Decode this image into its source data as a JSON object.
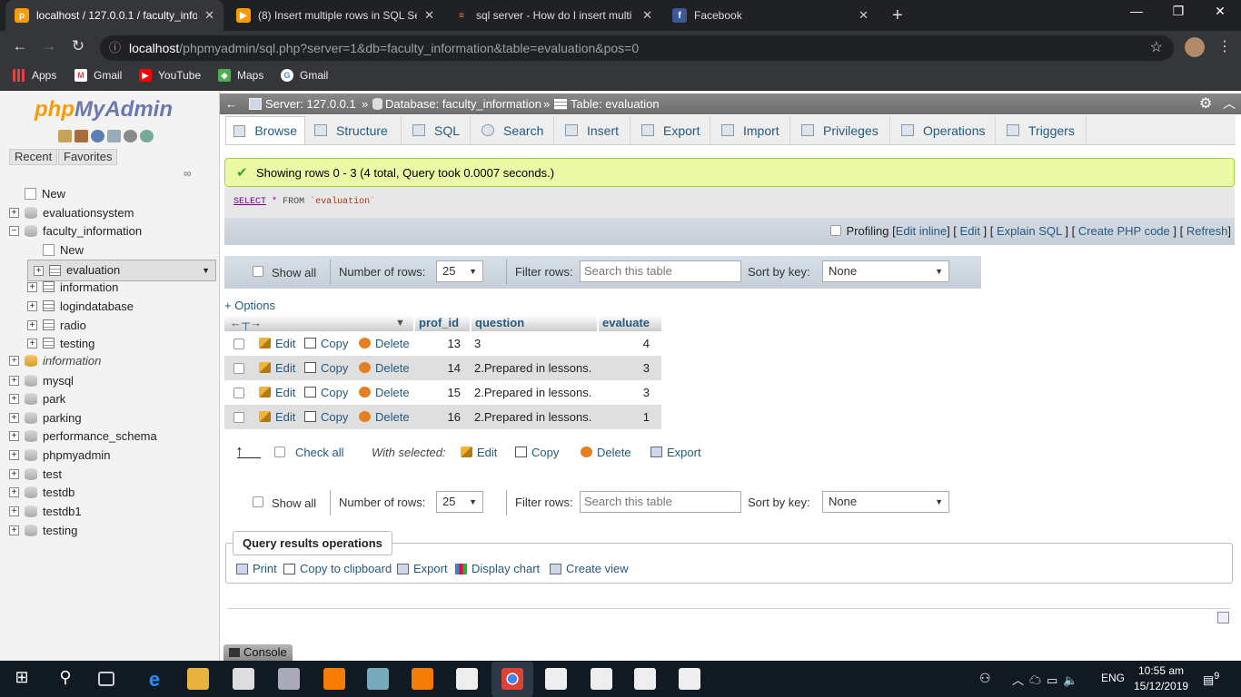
{
  "browser": {
    "tabs": [
      {
        "title": "localhost / 127.0.0.1 / faculty_info",
        "favicon": "phpmyadmin-icon",
        "active": true
      },
      {
        "title": "(8) Insert multiple rows in SQL Se",
        "favicon": "youtube-icon",
        "active": false
      },
      {
        "title": "sql server - How do I insert multi",
        "favicon": "stackoverflow-icon",
        "active": false
      },
      {
        "title": "Facebook",
        "favicon": "facebook-icon",
        "active": false
      }
    ],
    "new_tab": "+",
    "url_host": "localhost",
    "url_rest": "/phpmyadmin/sql.php?server=1&db=faculty_information&table=evaluation&pos=0",
    "bookmarks": [
      "Apps",
      "Gmail",
      "YouTube",
      "Maps",
      "Gmail"
    ]
  },
  "sidebar": {
    "logo_php": "php",
    "logo_myadmin": "MyAdmin",
    "tab_recent": "Recent",
    "tab_favorites": "Favorites",
    "tree": [
      {
        "label": "New",
        "type": "new",
        "level": 0
      },
      {
        "label": "evaluationsystem",
        "type": "db",
        "level": 0
      },
      {
        "label": "faculty_information",
        "type": "db",
        "level": 0
      },
      {
        "label": "New",
        "type": "new",
        "level": 1
      },
      {
        "label": "evaluation",
        "type": "table",
        "level": 1,
        "selected": true
      },
      {
        "label": "information",
        "type": "table",
        "level": 1
      },
      {
        "label": "logindatabase",
        "type": "table",
        "level": 1
      },
      {
        "label": "radio",
        "type": "table",
        "level": 1
      },
      {
        "label": "testing",
        "type": "table",
        "level": 1
      },
      {
        "label": "information",
        "type": "db",
        "level": 0,
        "italic": true
      },
      {
        "label": "mysql",
        "type": "db",
        "level": 0
      },
      {
        "label": "park",
        "type": "db",
        "level": 0
      },
      {
        "label": "parking",
        "type": "db",
        "level": 0
      },
      {
        "label": "performance_schema",
        "type": "db",
        "level": 0
      },
      {
        "label": "phpmyadmin",
        "type": "db",
        "level": 0
      },
      {
        "label": "test",
        "type": "db",
        "level": 0
      },
      {
        "label": "testdb",
        "type": "db",
        "level": 0
      },
      {
        "label": "testdb1",
        "type": "db",
        "level": 0
      },
      {
        "label": "testing",
        "type": "db",
        "level": 0
      }
    ]
  },
  "breadcrumb": {
    "server": "Server: 127.0.0.1",
    "database": "Database: faculty_information",
    "table": "Table: evaluation",
    "sep": "»"
  },
  "tabs": [
    "Browse",
    "Structure",
    "SQL",
    "Search",
    "Insert",
    "Export",
    "Import",
    "Privileges",
    "Operations",
    "Triggers"
  ],
  "success_message": "Showing rows 0 - 3 (4 total, Query took 0.0007 seconds.)",
  "sql": {
    "select": "SELECT",
    "star": "*",
    "from": "FROM",
    "table": "`evaluation`"
  },
  "profiling": {
    "label": "Profiling",
    "links": [
      "Edit inline",
      "Edit",
      "Explain SQL",
      "Create PHP code",
      "Refresh"
    ]
  },
  "navbar": {
    "show_all": "Show all",
    "number_of_rows_label": "Number of rows:",
    "number_of_rows": "25",
    "filter_rows_label": "Filter rows:",
    "filter_placeholder": "Search this table",
    "sort_by_key_label": "Sort by key:",
    "sort_by_key": "None"
  },
  "options_link": "+ Options",
  "table": {
    "columns": [
      "prof_id",
      "question",
      "evaluate"
    ],
    "row_actions": {
      "edit": "Edit",
      "copy": "Copy",
      "delete": "Delete"
    },
    "rows": [
      {
        "prof_id": "13",
        "question": "3",
        "evaluate": "4"
      },
      {
        "prof_id": "14",
        "question": "2.Prepared in lessons.",
        "evaluate": "3"
      },
      {
        "prof_id": "15",
        "question": "2.Prepared in lessons.",
        "evaluate": "3"
      },
      {
        "prof_id": "16",
        "question": "2.Prepared in lessons.",
        "evaluate": "1"
      }
    ]
  },
  "with_selected": {
    "check_all": "Check all",
    "label": "With selected:",
    "edit": "Edit",
    "copy": "Copy",
    "delete": "Delete",
    "export": "Export"
  },
  "query_results_operations": {
    "title": "Query results operations",
    "actions": [
      "Print",
      "Copy to clipboard",
      "Export",
      "Display chart",
      "Create view"
    ]
  },
  "console_label": "Console",
  "taskbar": {
    "time": "10:55 am",
    "date": "15/12/2019",
    "language": "ENG",
    "notifications": "9"
  }
}
